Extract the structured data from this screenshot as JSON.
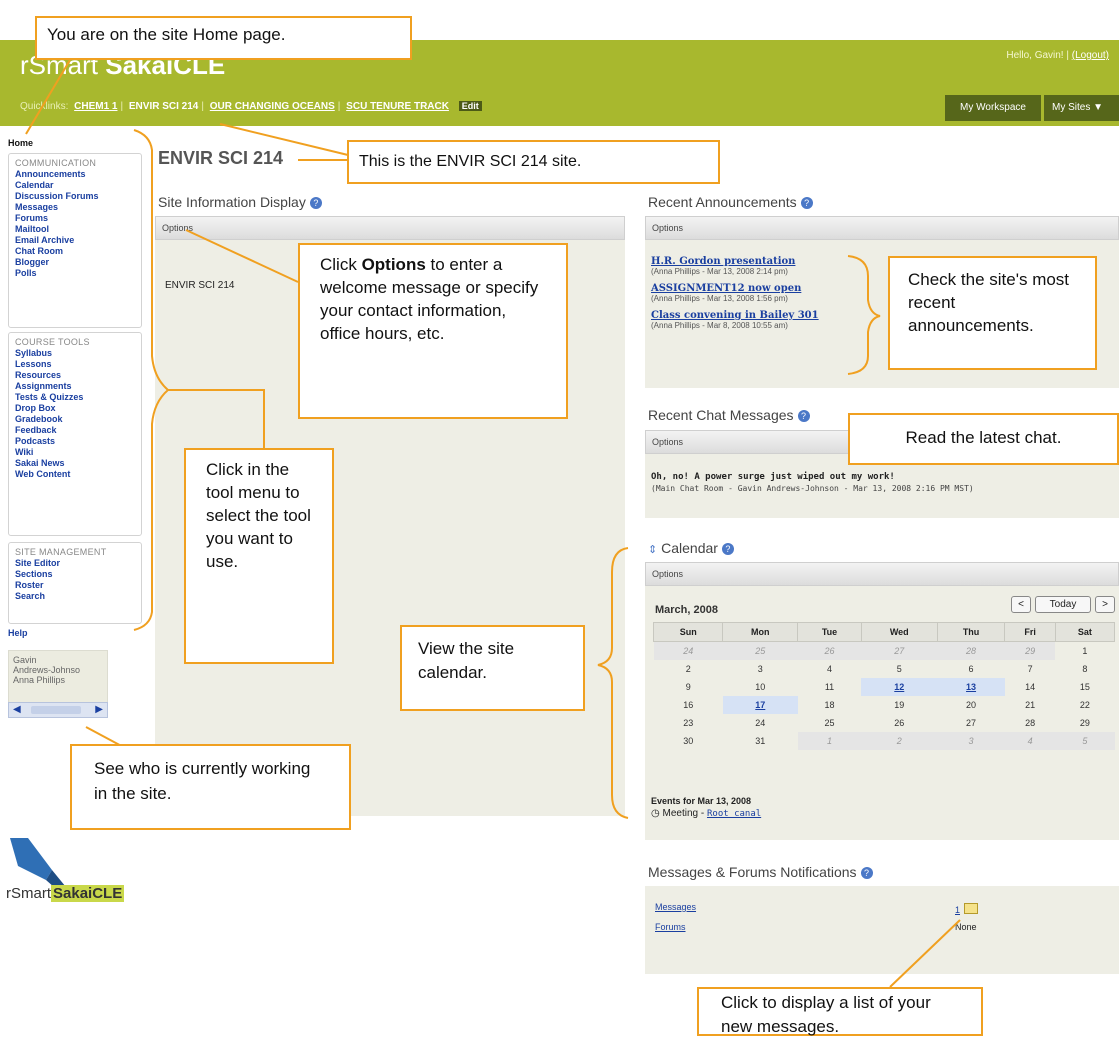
{
  "header": {
    "brand_prefix": "rSmart",
    "brand_main": "SakaiCLE",
    "greeting": "Hello, Gavin! |",
    "logout": "(Logout)",
    "quicklinks_label": "Quicklinks:",
    "quicklinks": [
      "CHEM1 1",
      "ENVIR SCI 214",
      "OUR CHANGING OCEANS",
      "SCU TENURE TRACK"
    ],
    "edit": "Edit",
    "my_workspace": "My Workspace",
    "my_sites": "My Sites"
  },
  "menu": {
    "home": "Home",
    "communication_header": "COMMUNICATION",
    "communication": [
      "Announcements",
      "Calendar",
      "Discussion Forums",
      "Messages",
      "Forums",
      "Mailtool",
      "Email Archive",
      "Chat Room",
      "Blogger",
      "Polls"
    ],
    "course_header": "COURSE TOOLS",
    "course": [
      "Syllabus",
      "Lessons",
      "Resources",
      "Assignments",
      "Tests & Quizzes",
      "Drop Box",
      "Gradebook",
      "Feedback",
      "Podcasts",
      "Wiki",
      "Sakai News",
      "Web Content"
    ],
    "site_header": "SITE MANAGEMENT",
    "site": [
      "Site Editor",
      "Sections",
      "Roster",
      "Search"
    ],
    "help": "Help"
  },
  "presence": {
    "users": [
      "Gavin",
      "Andrews-Johnso",
      "Anna Phillips"
    ]
  },
  "site_title": "ENVIR SCI 214",
  "site_info": {
    "title": "Site Information Display",
    "options": "Options",
    "content": "ENVIR SCI 214"
  },
  "announcements": {
    "title": "Recent Announcements",
    "options": "Options",
    "items": [
      {
        "title": "H.R. Gordon presentation",
        "meta": "(Anna Phillips - Mar 13, 2008 2:14 pm)"
      },
      {
        "title": "ASSIGNMENT12 now open",
        "meta": "(Anna Phillips - Mar 13, 2008 1:56 pm)"
      },
      {
        "title": "Class convening in Bailey 301",
        "meta": "(Anna Phillips - Mar 8, 2008 10:55 am)"
      }
    ]
  },
  "chat": {
    "title": "Recent Chat Messages",
    "options": "Options",
    "message": "Oh, no! A power surge just wiped out my work!",
    "meta": "(Main Chat Room - Gavin Andrews-Johnson - Mar 13, 2008 2:16 PM MST)"
  },
  "calendar": {
    "title": "Calendar",
    "options": "Options",
    "month": "March, 2008",
    "today": "Today",
    "prev": "<",
    "next": ">",
    "days": [
      "Sun",
      "Mon",
      "Tue",
      "Wed",
      "Thu",
      "Fri",
      "Sat"
    ],
    "weeks": [
      [
        "24",
        "25",
        "26",
        "27",
        "28",
        "29",
        "1"
      ],
      [
        "2",
        "3",
        "4",
        "5",
        "6",
        "7",
        "8"
      ],
      [
        "9",
        "10",
        "11",
        "12",
        "13",
        "14",
        "15"
      ],
      [
        "16",
        "17",
        "18",
        "19",
        "20",
        "21",
        "22"
      ],
      [
        "23",
        "24",
        "25",
        "26",
        "27",
        "28",
        "29"
      ],
      [
        "30",
        "31",
        "1",
        "2",
        "3",
        "4",
        "5"
      ]
    ],
    "events_label": "Events for Mar 13, 2008",
    "event_type": "Meeting -",
    "event_name": "Root canal"
  },
  "notifications": {
    "title": "Messages & Forums Notifications",
    "messages_label": "Messages",
    "messages_count": "1",
    "forums_label": "Forums",
    "forums_value": "None"
  },
  "footer_logo": {
    "prefix": "rSmart",
    "main": "SakaiCLE"
  },
  "callouts": {
    "home": "You are on the site Home page.",
    "site": "This is the ENVIR SCI 214 site.",
    "options_pre": "Click ",
    "options_bold": "Options",
    "options_post": " to enter a welcome message or specify your contact information, office hours, etc.",
    "announcements": "Check the site's most recent announcements.",
    "chat": "Read the latest chat.",
    "tool_menu": "Click in the tool menu to select the tool you want to use.",
    "calendar": "View the site calendar.",
    "presence": "See who is currently working in the site.",
    "messages": "Click to display a list of your new messages."
  },
  "colors": {
    "header": "#a8b82e",
    "callout_border": "#f0a020",
    "link": "#1a3fa0"
  }
}
